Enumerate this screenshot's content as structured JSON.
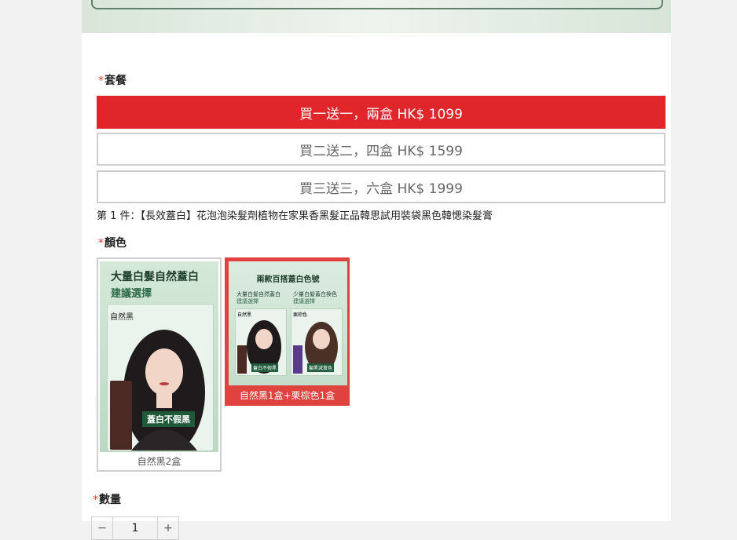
{
  "package": {
    "label": "套餐",
    "options": [
      "買一送一，兩盒 HK$ 1099",
      "買二送二，四盒 HK$ 1599",
      "買三送三，六盒 HK$ 1999"
    ],
    "selected_index": 0
  },
  "item_description": "第 1 件：【長效蓋白】花泡泡染髮劑植物在家果香黑髮正品韓思試用裝袋黑色韓愢染髮膏",
  "color": {
    "label": "顏色",
    "options": [
      {
        "caption": "自然黑2盒",
        "heading_line1": "大量白髮自然蓋白",
        "heading_line2": "建議選擇",
        "tag": "自然黑",
        "badge": "蓋白不假黑"
      },
      {
        "caption": "自然黑1盒+栗棕色1盒",
        "heading": "兩款百搭蓋白色號",
        "col1_title": "大量白髮自然蓋白",
        "col1_sub": "建議選擇",
        "col1_tag": "自然黑",
        "col1_badge": "蓋白不假黑",
        "col2_title": "少量白髮蓋白換色",
        "col2_sub": "建議選擇",
        "col2_tag": "栗棕色",
        "col2_badge": "顯黑減黃色"
      }
    ],
    "selected_index": 1
  },
  "quantity": {
    "label": "數量",
    "minus": "−",
    "value": "1",
    "plus": "+"
  },
  "colors": {
    "accent": "#e0262a",
    "required_star": "#e5412a",
    "card_green": "#2f6a4a"
  }
}
